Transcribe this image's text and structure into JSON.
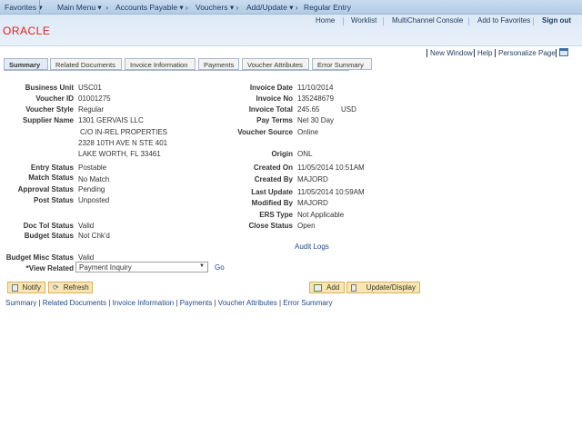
{
  "topnav": {
    "favorites": "Favorites",
    "breadcrumb": [
      "Main Menu",
      "Accounts Payable",
      "Vouchers",
      "Add/Update",
      "Regular Entry"
    ]
  },
  "header": {
    "links": [
      "Home",
      "Worklist",
      "MultiChannel Console",
      "Add to Favorites",
      "Sign out"
    ],
    "logo": "ORACLE"
  },
  "pagelinks": {
    "new_window": "New Window",
    "help": "Help",
    "personalize": "Personalize Page"
  },
  "tabs": [
    "Summary",
    "Related Documents",
    "Invoice Information",
    "Payments",
    "Voucher Attributes",
    "Error Summary"
  ],
  "left": {
    "business_unit": {
      "label": "Business Unit",
      "value": "USC01"
    },
    "voucher_id": {
      "label": "Voucher ID",
      "value": "01001275"
    },
    "voucher_style": {
      "label": "Voucher Style",
      "value": "Regular"
    },
    "supplier_name": {
      "label": "Supplier Name",
      "value": "1301 GERVAIS LLC",
      "address": [
        "C/O IN-REL PROPERTIES",
        "2328 10TH AVE N STE 401",
        "LAKE WORTH, FL  33461"
      ]
    },
    "entry_status": {
      "label": "Entry Status",
      "value": "Postable"
    },
    "match_status": {
      "label": "Match Status",
      "value": "No Match"
    },
    "approval_status": {
      "label": "Approval Status",
      "value": "Pending"
    },
    "post_status": {
      "label": "Post Status",
      "value": "Unposted"
    },
    "doc_tol_status": {
      "label": "Doc Tol Status",
      "value": "Valid"
    },
    "budget_status": {
      "label": "Budget Status",
      "value": "Not Chk'd"
    },
    "budget_misc_status": {
      "label": "Budget Misc Status",
      "value": "Valid"
    },
    "view_related": {
      "label": "*View Related",
      "value": "Payment Inquiry",
      "go": "Go"
    }
  },
  "right": {
    "invoice_date": {
      "label": "Invoice Date",
      "value": "11/10/2014"
    },
    "invoice_no": {
      "label": "Invoice No",
      "value": "135248679"
    },
    "invoice_total": {
      "label": "Invoice Total",
      "value": "245.65",
      "currency": "USD"
    },
    "pay_terms": {
      "label": "Pay Terms",
      "value": "Net 30 Day"
    },
    "voucher_source": {
      "label": "Voucher Source",
      "value": "Online"
    },
    "origin": {
      "label": "Origin",
      "value": "ONL"
    },
    "created_on": {
      "label": "Created On",
      "value": "11/05/2014 10:51AM"
    },
    "created_by": {
      "label": "Created By",
      "value": "MAJORD"
    },
    "last_update": {
      "label": "Last Update",
      "value": "11/05/2014 10:59AM"
    },
    "modified_by": {
      "label": "Modified By",
      "value": "MAJORD"
    },
    "ers_type": {
      "label": "ERS Type",
      "value": "Not Applicable"
    },
    "close_status": {
      "label": "Close Status",
      "value": "Open"
    },
    "audit_logs": "Audit Logs"
  },
  "buttons": {
    "notify": "Notify",
    "refresh": "Refresh",
    "add": "Add",
    "update_display": "Update/Display"
  },
  "bottom_links": [
    "Summary",
    "Related Documents",
    "Invoice Information",
    "Payments",
    "Voucher Attributes",
    "Error Summary"
  ],
  "colors": {
    "brand": "#e2231a",
    "link": "#1c4a8c",
    "button": "#fbe6b0"
  }
}
